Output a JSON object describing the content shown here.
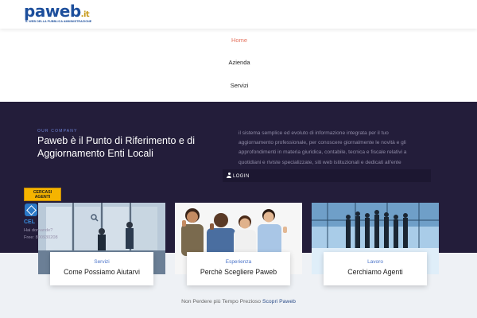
{
  "header": {
    "logo_main": "paweb",
    "logo_suffix": ".it",
    "logo_tagline": "IL WEB DELLA PUBBLICA AMMINISTRAZIONE"
  },
  "nav": {
    "items": [
      {
        "label": "Home",
        "active": true
      },
      {
        "label": "Azienda",
        "active": false
      },
      {
        "label": "Servizi",
        "active": false
      }
    ]
  },
  "hero": {
    "eyebrow": "OUR COMPANY",
    "title": "Paweb è il Punto di Riferimento e di Aggiornamento Enti Locali",
    "description_lines": [
      "il sistema semplice ed evoluto di informazione integrata per il tuo",
      "aggiornamento professionale, per conoscere giornalmente le novità e gli",
      "approfondimenti in materia giuridica, contabile, tecnica e fiscale relativi a",
      "quotidiani e riviste specializzate, siti web istituzionali e dedicati all'ente"
    ],
    "login_label": "LOGIN"
  },
  "promo": {
    "badge_line1": "CERCASI",
    "badge_line2": "AGENTI",
    "widget_title": "CEL",
    "widget_line1": "Hai domande?",
    "widget_line2": "Free: 800930208"
  },
  "cards": [
    {
      "kicker": "Servizi",
      "title": "Come Possiamo Aiutarvi",
      "image_icon": "office-meeting-photo"
    },
    {
      "kicker": "Esperienza",
      "title": "Perchè Scegliere Paweb",
      "image_icon": "team-thumbs-up-photo"
    },
    {
      "kicker": "Lavoro",
      "title": "Cerchiamo Agenti",
      "image_icon": "business-silhouettes-photo"
    }
  ],
  "footer": {
    "text": "Non Perdere più Tempo Prezioso",
    "link": "Scopri Paweb"
  },
  "colors": {
    "hero_bg": "#231d3a",
    "accent_orange": "#e5735f",
    "kicker_blue": "#4a73c9",
    "badge_yellow": "#f5b400"
  }
}
